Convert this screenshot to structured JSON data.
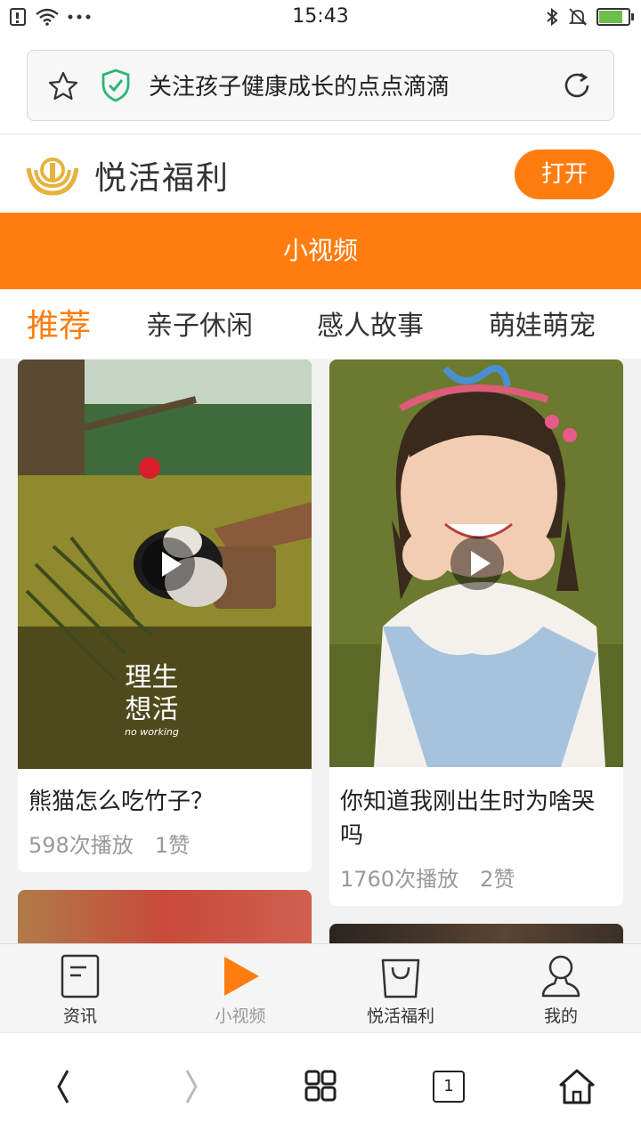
{
  "status_bar": {
    "time": "15:43",
    "left_icons": [
      "sim-icon",
      "wifi-icon",
      "more-dots-icon"
    ],
    "right_icons": [
      "bluetooth-icon",
      "mute-icon",
      "battery-icon"
    ]
  },
  "address_bar": {
    "url_text": "关注孩子健康成长的点点滴滴",
    "icons": [
      "star-icon",
      "shield-icon",
      "reload-icon"
    ]
  },
  "app_banner": {
    "name": "悦活福利",
    "open_button": "打开"
  },
  "section_header": "小视频",
  "tabs": [
    {
      "label": "推荐",
      "active": true
    },
    {
      "label": "亲子休闲",
      "active": false
    },
    {
      "label": "感人故事",
      "active": false
    },
    {
      "label": "萌娃萌宠",
      "active": false
    }
  ],
  "videos": [
    {
      "title": "熊猫怎么吃竹子？",
      "plays": "598次播放",
      "likes": "1赞",
      "overlay_text_1": "理生",
      "overlay_text_2": "想活",
      "overlay_text_3": "no working"
    },
    {
      "title": "你知道我刚出生时为啥哭吗",
      "plays": "1760次播放",
      "likes": "2赞"
    }
  ],
  "app_nav": [
    {
      "label": "资讯",
      "icon": "news-icon",
      "active": false
    },
    {
      "label": "小视频",
      "icon": "play-icon",
      "active": true
    },
    {
      "label": "悦活福利",
      "icon": "shopping-bag-icon",
      "active": false
    },
    {
      "label": "我的",
      "icon": "person-icon",
      "active": false
    }
  ],
  "browser_bar": {
    "tab_count": "1",
    "icons": [
      "back-icon",
      "forward-icon",
      "menu-grid-icon",
      "tabs-icon",
      "home-icon"
    ]
  },
  "colors": {
    "accent": "#ff7d0f",
    "battery": "#6dbf4c",
    "shield": "#2bb673"
  }
}
